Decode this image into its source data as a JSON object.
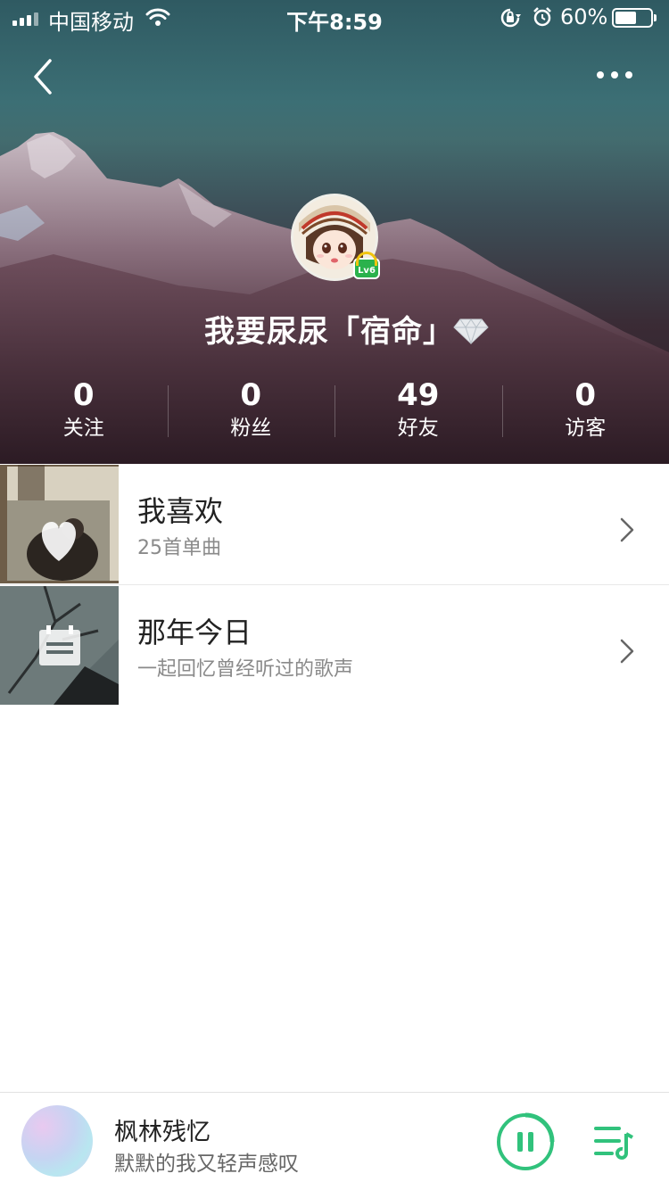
{
  "status_bar": {
    "carrier": "中国移动",
    "time": "下午8:59",
    "battery_percent_text": "60%",
    "battery_level": 0.6,
    "icons": [
      "signal-icon",
      "wifi-icon",
      "orientation-lock-icon",
      "alarm-icon",
      "battery-icon"
    ]
  },
  "header": {
    "back_icon": "chevron-left-icon",
    "more_icon": "more-dots-icon"
  },
  "profile": {
    "username": "我要尿尿「宿命」",
    "level_badge": "Lv6",
    "vip_icon": "diamond-icon",
    "stats": [
      {
        "value": "0",
        "label": "关注"
      },
      {
        "value": "0",
        "label": "粉丝"
      },
      {
        "value": "49",
        "label": "好友"
      },
      {
        "value": "0",
        "label": "访客"
      }
    ]
  },
  "list": {
    "items": [
      {
        "title": "我喜欢",
        "subtitle": "25首单曲",
        "icon": "heart-icon"
      },
      {
        "title": "那年今日",
        "subtitle": "一起回忆曾经听过的歌声",
        "icon": "calendar-icon"
      }
    ]
  },
  "player": {
    "song_title": "枫林残忆",
    "song_subtitle": "默默的我又轻声感叹",
    "play_icon": "pause-icon",
    "playlist_icon": "playlist-icon"
  },
  "colors": {
    "accent": "#31c27c",
    "level_badge": "#2bb24c"
  }
}
